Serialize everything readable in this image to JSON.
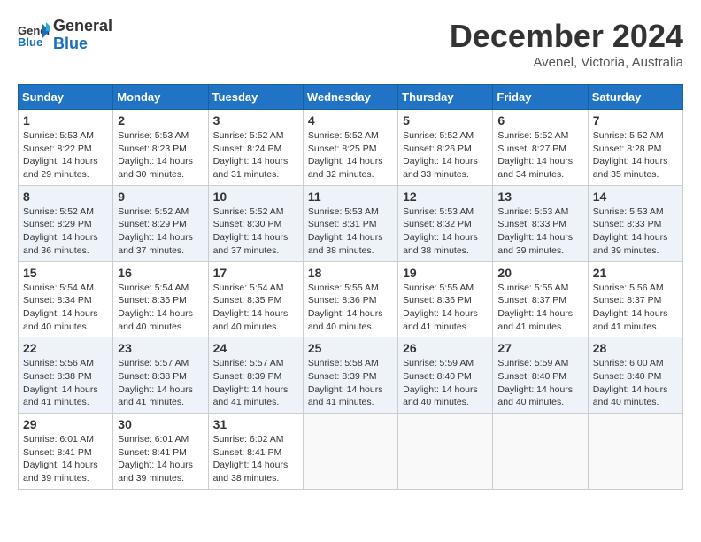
{
  "header": {
    "logo_line1": "General",
    "logo_line2": "Blue",
    "month_title": "December 2024",
    "location": "Avenel, Victoria, Australia"
  },
  "days_of_week": [
    "Sunday",
    "Monday",
    "Tuesday",
    "Wednesday",
    "Thursday",
    "Friday",
    "Saturday"
  ],
  "weeks": [
    [
      {
        "day": "1",
        "sunrise": "5:53 AM",
        "sunset": "8:22 PM",
        "daylight": "14 hours and 29 minutes."
      },
      {
        "day": "2",
        "sunrise": "5:53 AM",
        "sunset": "8:23 PM",
        "daylight": "14 hours and 30 minutes."
      },
      {
        "day": "3",
        "sunrise": "5:52 AM",
        "sunset": "8:24 PM",
        "daylight": "14 hours and 31 minutes."
      },
      {
        "day": "4",
        "sunrise": "5:52 AM",
        "sunset": "8:25 PM",
        "daylight": "14 hours and 32 minutes."
      },
      {
        "day": "5",
        "sunrise": "5:52 AM",
        "sunset": "8:26 PM",
        "daylight": "14 hours and 33 minutes."
      },
      {
        "day": "6",
        "sunrise": "5:52 AM",
        "sunset": "8:27 PM",
        "daylight": "14 hours and 34 minutes."
      },
      {
        "day": "7",
        "sunrise": "5:52 AM",
        "sunset": "8:28 PM",
        "daylight": "14 hours and 35 minutes."
      }
    ],
    [
      {
        "day": "8",
        "sunrise": "5:52 AM",
        "sunset": "8:29 PM",
        "daylight": "14 hours and 36 minutes."
      },
      {
        "day": "9",
        "sunrise": "5:52 AM",
        "sunset": "8:29 PM",
        "daylight": "14 hours and 37 minutes."
      },
      {
        "day": "10",
        "sunrise": "5:52 AM",
        "sunset": "8:30 PM",
        "daylight": "14 hours and 37 minutes."
      },
      {
        "day": "11",
        "sunrise": "5:53 AM",
        "sunset": "8:31 PM",
        "daylight": "14 hours and 38 minutes."
      },
      {
        "day": "12",
        "sunrise": "5:53 AM",
        "sunset": "8:32 PM",
        "daylight": "14 hours and 38 minutes."
      },
      {
        "day": "13",
        "sunrise": "5:53 AM",
        "sunset": "8:33 PM",
        "daylight": "14 hours and 39 minutes."
      },
      {
        "day": "14",
        "sunrise": "5:53 AM",
        "sunset": "8:33 PM",
        "daylight": "14 hours and 39 minutes."
      }
    ],
    [
      {
        "day": "15",
        "sunrise": "5:54 AM",
        "sunset": "8:34 PM",
        "daylight": "14 hours and 40 minutes."
      },
      {
        "day": "16",
        "sunrise": "5:54 AM",
        "sunset": "8:35 PM",
        "daylight": "14 hours and 40 minutes."
      },
      {
        "day": "17",
        "sunrise": "5:54 AM",
        "sunset": "8:35 PM",
        "daylight": "14 hours and 40 minutes."
      },
      {
        "day": "18",
        "sunrise": "5:55 AM",
        "sunset": "8:36 PM",
        "daylight": "14 hours and 40 minutes."
      },
      {
        "day": "19",
        "sunrise": "5:55 AM",
        "sunset": "8:36 PM",
        "daylight": "14 hours and 41 minutes."
      },
      {
        "day": "20",
        "sunrise": "5:55 AM",
        "sunset": "8:37 PM",
        "daylight": "14 hours and 41 minutes."
      },
      {
        "day": "21",
        "sunrise": "5:56 AM",
        "sunset": "8:37 PM",
        "daylight": "14 hours and 41 minutes."
      }
    ],
    [
      {
        "day": "22",
        "sunrise": "5:56 AM",
        "sunset": "8:38 PM",
        "daylight": "14 hours and 41 minutes."
      },
      {
        "day": "23",
        "sunrise": "5:57 AM",
        "sunset": "8:38 PM",
        "daylight": "14 hours and 41 minutes."
      },
      {
        "day": "24",
        "sunrise": "5:57 AM",
        "sunset": "8:39 PM",
        "daylight": "14 hours and 41 minutes."
      },
      {
        "day": "25",
        "sunrise": "5:58 AM",
        "sunset": "8:39 PM",
        "daylight": "14 hours and 41 minutes."
      },
      {
        "day": "26",
        "sunrise": "5:59 AM",
        "sunset": "8:40 PM",
        "daylight": "14 hours and 40 minutes."
      },
      {
        "day": "27",
        "sunrise": "5:59 AM",
        "sunset": "8:40 PM",
        "daylight": "14 hours and 40 minutes."
      },
      {
        "day": "28",
        "sunrise": "6:00 AM",
        "sunset": "8:40 PM",
        "daylight": "14 hours and 40 minutes."
      }
    ],
    [
      {
        "day": "29",
        "sunrise": "6:01 AM",
        "sunset": "8:41 PM",
        "daylight": "14 hours and 39 minutes."
      },
      {
        "day": "30",
        "sunrise": "6:01 AM",
        "sunset": "8:41 PM",
        "daylight": "14 hours and 39 minutes."
      },
      {
        "day": "31",
        "sunrise": "6:02 AM",
        "sunset": "8:41 PM",
        "daylight": "14 hours and 38 minutes."
      },
      null,
      null,
      null,
      null
    ]
  ]
}
